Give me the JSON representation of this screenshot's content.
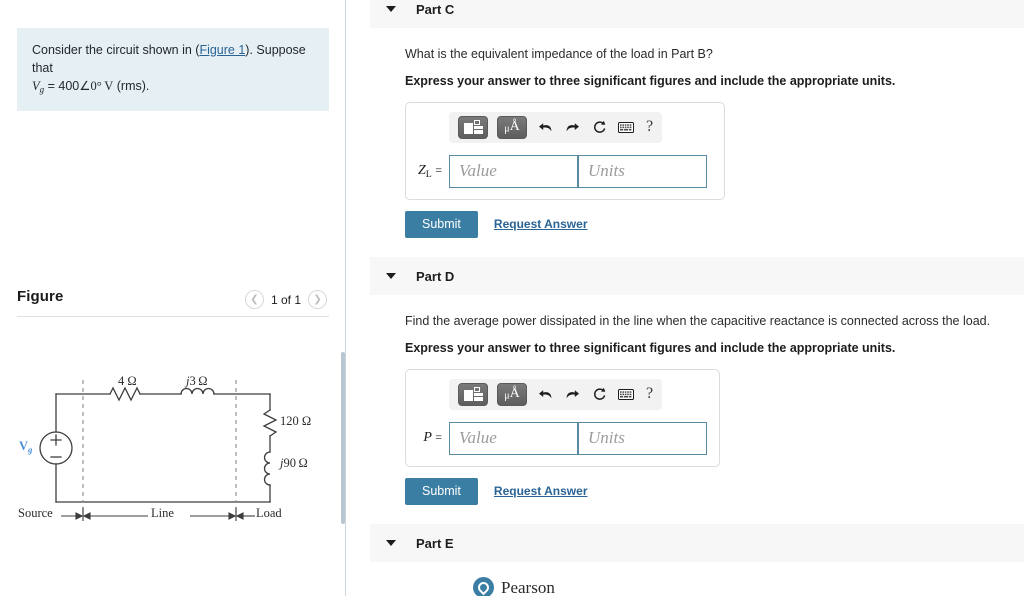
{
  "problem": {
    "text_before_link": "Consider the circuit shown in (",
    "figure_link": "Figure 1",
    "text_after_link": "). Suppose that",
    "given_var": "V",
    "given_var_sub": "g",
    "given_equals": " = 400",
    "given_angle": "∠0°",
    "given_unit": "V",
    "given_tail": "(rms)."
  },
  "figure": {
    "title": "Figure",
    "pager_label": "1 of 1",
    "prev_icon": "chevron-left-icon",
    "next_icon": "chevron-right-icon",
    "labels": {
      "resistor_line": "4 Ω",
      "inductor_line": "j3 Ω",
      "load_resistor": "120 Ω",
      "load_inductor": "j90 Ω",
      "source_label": "V",
      "source_label_sub": "g",
      "region_source": "Source",
      "region_line": "Line",
      "region_load": "Load"
    }
  },
  "parts": [
    {
      "id": "part-c",
      "title": "Part C",
      "caret": "caret-down-icon",
      "expanded": true,
      "question": "What is the equivalent impedance of the load in Part B?",
      "instruction": "Express your answer to three significant figures and include the appropriate units.",
      "answer": {
        "var_symbol": "Z",
        "var_sub": "L",
        "equals": "=",
        "value_placeholder": "Value",
        "units_placeholder": "Units",
        "value_current": "",
        "units_current": ""
      },
      "toolbar": [
        {
          "name": "template-icon",
          "label": ""
        },
        {
          "name": "units-icon",
          "label": "μÅ"
        },
        {
          "name": "undo-icon",
          "label": ""
        },
        {
          "name": "redo-icon",
          "label": ""
        },
        {
          "name": "reset-icon",
          "label": ""
        },
        {
          "name": "keyboard-icon",
          "label": ""
        },
        {
          "name": "help-icon",
          "label": "?"
        }
      ],
      "submit_label": "Submit",
      "request_label": "Request Answer"
    },
    {
      "id": "part-d",
      "title": "Part D",
      "caret": "caret-down-icon",
      "expanded": true,
      "question": "Find the average power dissipated in the line when the capacitive reactance is connected across the load.",
      "instruction": "Express your answer to three significant figures and include the appropriate units.",
      "answer": {
        "var_symbol": "P",
        "var_sub": "",
        "equals": "=",
        "value_placeholder": "Value",
        "units_placeholder": "Units",
        "value_current": "",
        "units_current": ""
      },
      "toolbar": [
        {
          "name": "template-icon",
          "label": ""
        },
        {
          "name": "units-icon",
          "label": "μÅ"
        },
        {
          "name": "undo-icon",
          "label": ""
        },
        {
          "name": "redo-icon",
          "label": ""
        },
        {
          "name": "reset-icon",
          "label": ""
        },
        {
          "name": "keyboard-icon",
          "label": ""
        },
        {
          "name": "help-icon",
          "label": "?"
        }
      ],
      "submit_label": "Submit",
      "request_label": "Request Answer"
    },
    {
      "id": "part-e",
      "title": "Part E",
      "caret": "caret-down-icon",
      "expanded": false
    }
  ],
  "footer": {
    "brand": "Pearson",
    "logo_icon": "pearson-logo-icon"
  },
  "colors": {
    "accent_blue": "#3b7ea4",
    "link_blue": "#2a6496",
    "problem_bg": "#e6eff3",
    "part_header_bg": "#f7f7f7",
    "source_label_blue": "#4a90d9",
    "input_border": "#5a8ba3"
  }
}
